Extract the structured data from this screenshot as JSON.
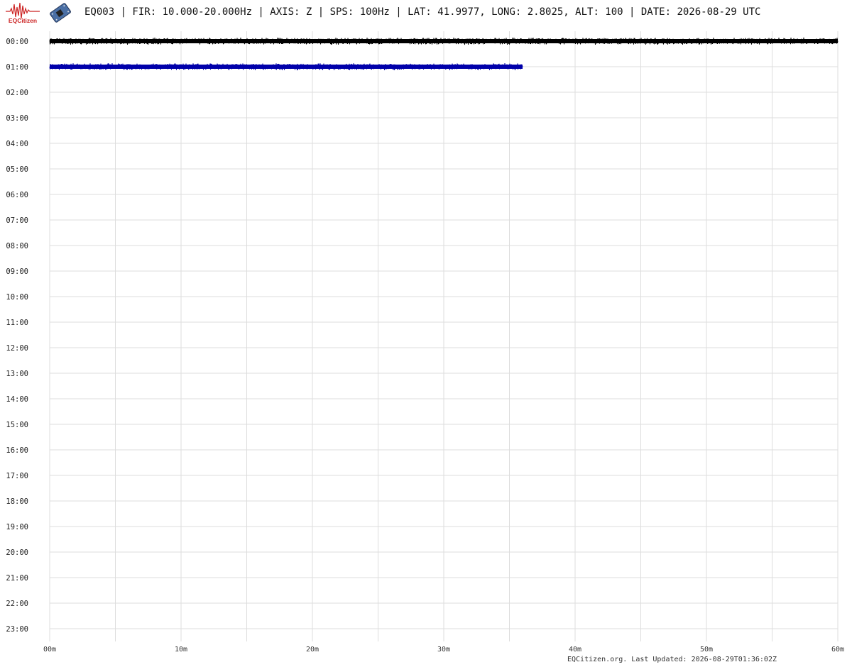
{
  "header": {
    "logo_text": "EQCitizen",
    "title": "EQ003 | FIR: 10.000-20.000Hz | AXIS: Z | SPS: 100Hz | LAT: 41.9977, LONG: 2.8025, ALT: 100 | DATE: 2026-08-29 UTC"
  },
  "footer": {
    "text": "EQCitizen.org. Last Updated: 2026-08-29T01:36:02Z"
  },
  "colors": {
    "brand": "#cc2222",
    "trace_even": "#000000",
    "trace_odd": "#0000aa",
    "grid": "#dddddd"
  },
  "chart_data": {
    "type": "line",
    "title": "",
    "xlabel": "",
    "ylabel": "",
    "x_ticks": [
      "00m",
      "10m",
      "20m",
      "30m",
      "40m",
      "50m",
      "60m"
    ],
    "x_range_minutes": [
      0,
      60
    ],
    "x_minor_step_minutes": 5,
    "y_ticks": [
      "00:00",
      "01:00",
      "02:00",
      "03:00",
      "04:00",
      "05:00",
      "06:00",
      "07:00",
      "08:00",
      "09:00",
      "10:00",
      "11:00",
      "12:00",
      "13:00",
      "14:00",
      "15:00",
      "16:00",
      "17:00",
      "18:00",
      "19:00",
      "20:00",
      "21:00",
      "22:00",
      "23:00"
    ],
    "grid": true,
    "series": [
      {
        "hour": "00:00",
        "start_minute": 0,
        "end_minute": 60,
        "color": "#000000"
      },
      {
        "hour": "01:00",
        "start_minute": 0,
        "end_minute": 36,
        "color": "#0000aa"
      }
    ]
  }
}
